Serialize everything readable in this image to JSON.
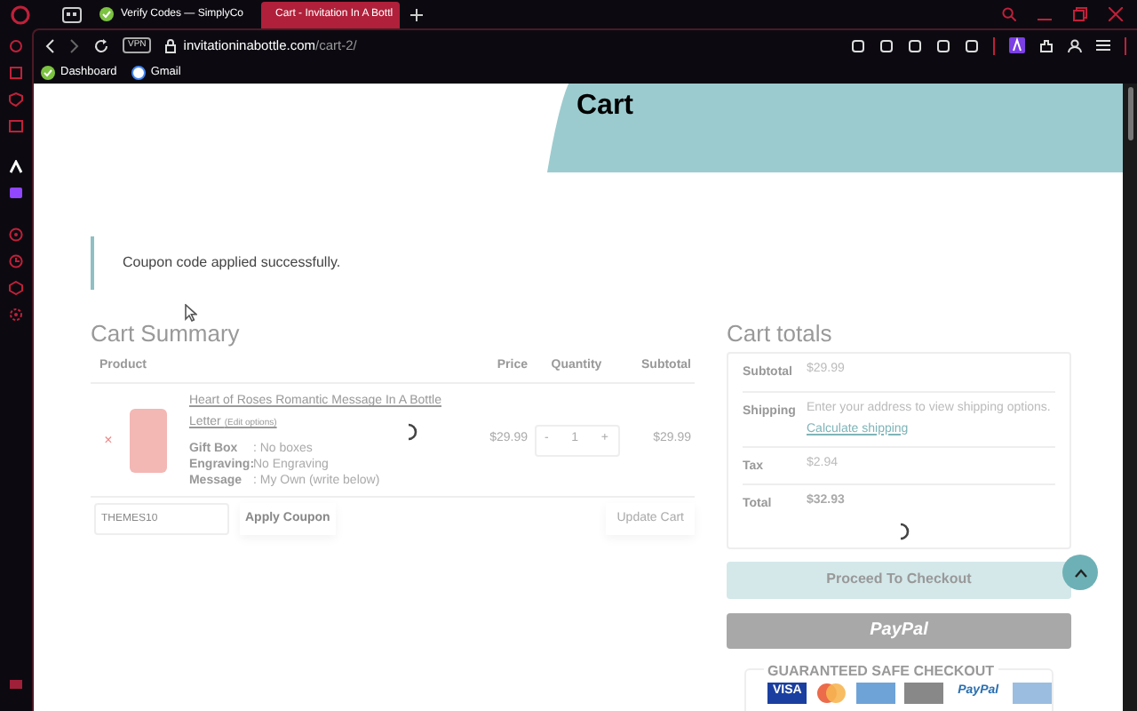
{
  "browser": {
    "tabs": [
      {
        "title": "Verify Codes — SimplyCo",
        "selected": false
      },
      {
        "title": "Cart - Invitation In A Bottl",
        "selected": true
      }
    ],
    "vpn": "VPN",
    "url_domain": "invitationinabottle.com",
    "url_path": "/cart-2/",
    "bookmarks": [
      {
        "label": "Dashboard"
      },
      {
        "label": "Gmail"
      }
    ]
  },
  "page": {
    "title": "Cart",
    "notice": "Coupon code applied successfully.",
    "summary": {
      "heading": "Cart Summary",
      "columns": [
        "Product",
        "Price",
        "Quantity",
        "Subtotal"
      ],
      "items": [
        {
          "remove": "×",
          "name": "Heart of Roses Romantic Message In A Bottle Letter",
          "edit": "(Edit options)",
          "options": [
            {
              "label": "Gift Box",
              "value": ": No boxes"
            },
            {
              "label": "Engraving:",
              "value": "No Engraving"
            },
            {
              "label": "Message",
              "value": ": My Own (write below)"
            }
          ],
          "price": "$29.99",
          "minus": "-",
          "quantity": "1",
          "plus": "+",
          "subtotal": "$29.99",
          "loading": true
        }
      ],
      "coupon_value": "THEMES10",
      "apply_button": "Apply Coupon",
      "update_button": "Update Cart",
      "update_disabled": true
    },
    "totals": {
      "heading": "Cart totals",
      "rows": [
        {
          "label": "Subtotal",
          "value": "$29.99"
        },
        {
          "label": "Shipping",
          "value": "Enter your address to view shipping options.",
          "link": "Calculate shipping"
        },
        {
          "label": "Tax",
          "value": "$2.94"
        },
        {
          "label": "Total",
          "value": "$32.93",
          "bold": true
        }
      ],
      "loading": true,
      "checkout_button": "Proceed To Checkout",
      "paypal_button": "PayPal",
      "safe_heading": "GUARANTEED SAFE CHECKOUT",
      "payment_logos": [
        {
          "kind": "visa",
          "label": "VISA"
        },
        {
          "kind": "mastercard"
        },
        {
          "kind": "amex"
        },
        {
          "kind": "discover"
        },
        {
          "kind": "paypal",
          "label": "PayPal"
        },
        {
          "kind": "other"
        }
      ]
    }
  }
}
